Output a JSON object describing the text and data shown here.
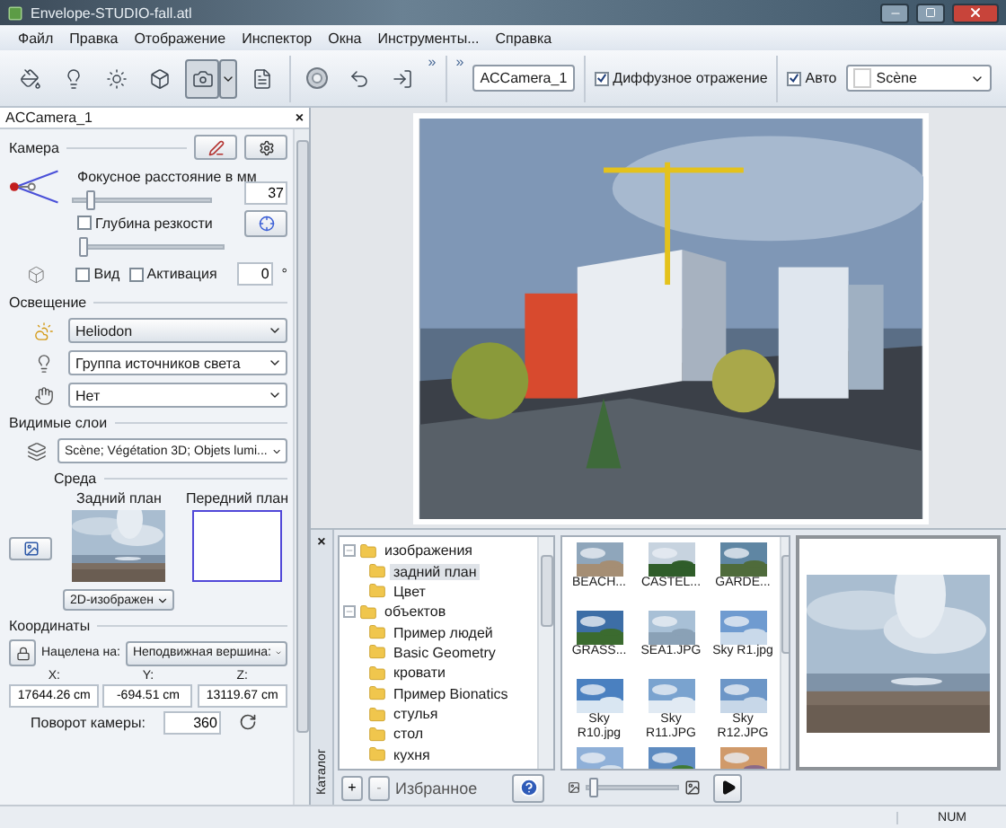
{
  "window": {
    "title": "Envelope-STUDIO-fall.atl"
  },
  "menu": [
    "Файл",
    "Правка",
    "Отображение",
    "Инспектор",
    "Окна",
    "Инструменты...",
    "Справка"
  ],
  "toolbar": {
    "tools": [
      {
        "kind": "paint",
        "selected": false
      },
      {
        "kind": "bulb",
        "selected": false
      },
      {
        "kind": "sun",
        "selected": false
      },
      {
        "kind": "cube",
        "selected": false
      },
      {
        "kind": "camera",
        "selected": true
      }
    ],
    "extra_tools": [
      {
        "kind": "sphere"
      },
      {
        "kind": "undo"
      },
      {
        "kind": "import"
      }
    ],
    "overflow": [
      "»",
      "»"
    ],
    "camera_select": "ACCamera_1",
    "diffuse": {
      "label": "Диффузное отражение",
      "checked": true
    },
    "auto": {
      "label": "Авто",
      "checked": true
    },
    "scene_select": "Scène"
  },
  "left_panel": {
    "title": "ACCamera_1",
    "close": "×",
    "camera": {
      "heading": "Камера",
      "focal": {
        "label": "Фокусное расстояние в мм",
        "level": 0.12,
        "value": "37"
      },
      "dof": {
        "label": "Глубина резкости",
        "checked": false,
        "level": 0
      },
      "view": {
        "label": "Вид",
        "checked": false
      },
      "activation": {
        "label": "Активация",
        "checked": false
      },
      "angle": "0",
      "degree": "°"
    },
    "lighting": {
      "heading": "Освещение",
      "selects": [
        {
          "kind": "weather",
          "value": "Heliodon"
        },
        {
          "kind": "bulb",
          "value": "Группа источников света"
        },
        {
          "kind": "hand",
          "value": "Нет"
        }
      ]
    },
    "layers": {
      "heading": "Видимые слои",
      "value": "Scène; Végétation 3D; Objets lumi..."
    },
    "environment": {
      "heading": "Среда",
      "background_label": "Задний план",
      "foreground_label": "Передний план",
      "mode": "2D-изображен"
    },
    "coordinates": {
      "heading": "Координаты",
      "target_label": "Нацелена на:",
      "target_value": "Неподвижная вершина:",
      "axes": [
        {
          "label": "X:",
          "value": "17644.26 cm"
        },
        {
          "label": "Y:",
          "value": "-694.51 cm"
        },
        {
          "label": "Z:",
          "value": "13119.67 cm"
        }
      ],
      "rotation_label": "Поворот камеры:",
      "rotation_value": "360"
    }
  },
  "catalog": {
    "tab": "Каталог",
    "close": "×",
    "tree": [
      {
        "label": "изображения",
        "expanded": true,
        "selected": false,
        "children": [
          {
            "label": "задний план",
            "selected": true
          },
          {
            "label": "Цвет",
            "selected": false
          }
        ]
      },
      {
        "label": "объектов",
        "expanded": true,
        "selected": false,
        "children": [
          {
            "label": "Пример людей",
            "selected": false
          },
          {
            "label": "Basic Geometry",
            "selected": false
          },
          {
            "label": "кровати",
            "selected": false
          },
          {
            "label": "Пример Bionatics",
            "selected": false
          },
          {
            "label": "стулья",
            "selected": false
          },
          {
            "label": "стол",
            "selected": false
          },
          {
            "label": "кухня",
            "selected": false
          }
        ]
      }
    ],
    "thumbnails": [
      {
        "kind": "picture",
        "label": "BEACH..."
      },
      {
        "kind": "picture",
        "label": "CASTEL..."
      },
      {
        "kind": "picture",
        "label": "GARDE..."
      },
      {
        "kind": "picture",
        "label": "GRASS..."
      },
      {
        "kind": "picture",
        "label": "SEA1.JPG"
      },
      {
        "kind": "picture",
        "label": "Sky R1.jpg"
      },
      {
        "kind": "picture",
        "label": "Sky R10.jpg"
      },
      {
        "kind": "picture",
        "label": "Sky R11.JPG"
      },
      {
        "kind": "picture",
        "label": "Sky R12.JPG"
      },
      {
        "kind": "picture"
      },
      {
        "kind": "picture"
      },
      {
        "kind": "picture"
      }
    ],
    "plus": "+",
    "minus": "-",
    "favorites": "Избранное",
    "zoom": {
      "level": 0.05
    }
  },
  "status_bar": {
    "indicator": "NUM"
  }
}
